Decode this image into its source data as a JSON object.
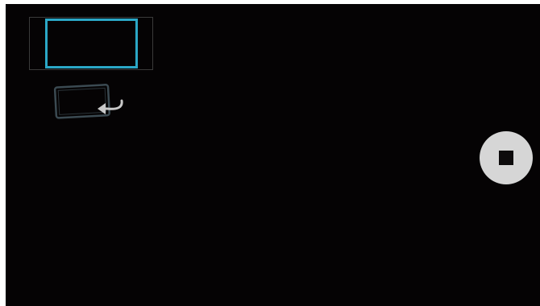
{
  "camera": {
    "background_color": "#050304",
    "accent_color": "#2ba7c6",
    "controls": {
      "preview_thumbnail_icon": "preview-frame-icon",
      "rotate_icon": "rotate-device-icon",
      "record_button_icon": "stop-icon",
      "record_button_color": "#d6d6d6"
    }
  }
}
